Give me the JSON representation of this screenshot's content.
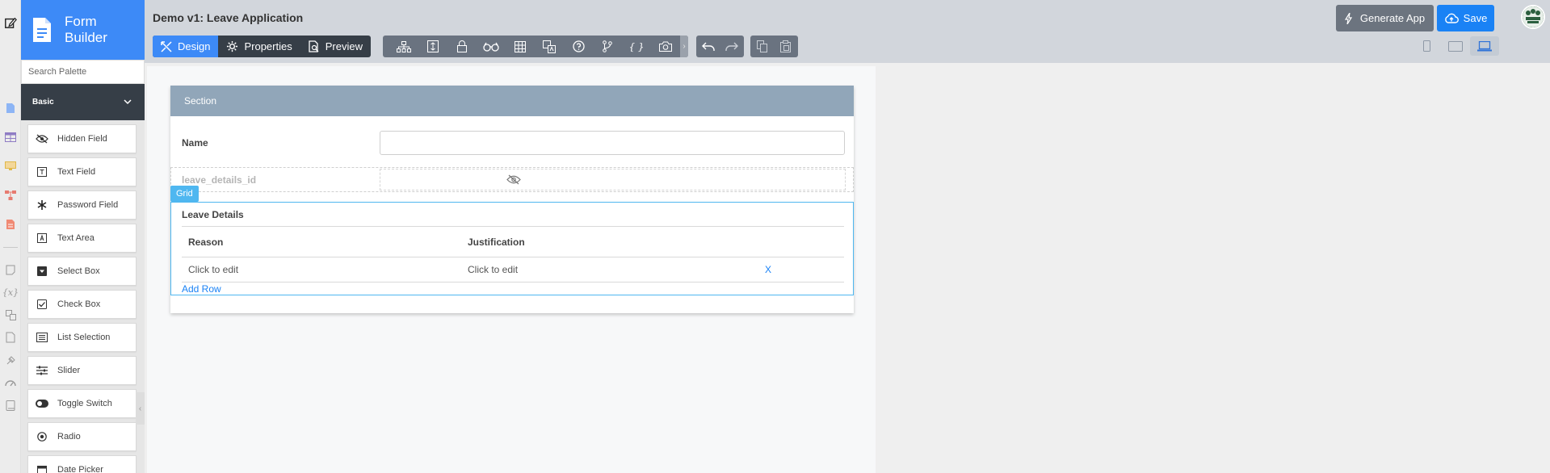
{
  "app": {
    "brand_line1": "Form",
    "brand_line2": "Builder",
    "title": "Demo v1: Leave Application",
    "accent": "#3d8af7"
  },
  "rail": {
    "icons": [
      "edit-icon",
      "form-icon",
      "table-icon",
      "monitor-icon",
      "workflow-icon",
      "report-icon",
      "note-icon",
      "variable-icon",
      "translate-icon",
      "file-icon",
      "plugin-icon",
      "dashboard-icon",
      "book-icon"
    ]
  },
  "palette": {
    "search_placeholder": "Search Palette",
    "category": "Basic",
    "items": [
      {
        "label": "Hidden Field",
        "icon": "eye-slash-icon"
      },
      {
        "label": "Text Field",
        "icon": "text-field-icon"
      },
      {
        "label": "Password Field",
        "icon": "asterisk-icon"
      },
      {
        "label": "Text Area",
        "icon": "text-area-icon"
      },
      {
        "label": "Select Box",
        "icon": "select-box-icon"
      },
      {
        "label": "Check Box",
        "icon": "checkbox-icon"
      },
      {
        "label": "List Selection",
        "icon": "list-icon"
      },
      {
        "label": "Slider",
        "icon": "slider-icon"
      },
      {
        "label": "Toggle Switch",
        "icon": "toggle-icon"
      },
      {
        "label": "Radio",
        "icon": "radio-icon"
      },
      {
        "label": "Date Picker",
        "icon": "calendar-icon"
      }
    ]
  },
  "toolbar": {
    "modes": [
      {
        "label": "Design",
        "icon": "design-icon",
        "active": true
      },
      {
        "label": "Properties",
        "icon": "gear-icon",
        "active": false
      },
      {
        "label": "Preview",
        "icon": "preview-icon",
        "active": false
      }
    ],
    "tools": [
      "tree-icon",
      "column-icon",
      "lock-icon",
      "glasses-icon",
      "grid-icon",
      "translate-icon",
      "help-icon",
      "branch-icon",
      "braces-icon",
      "camera-icon"
    ],
    "history": [
      "undo-icon",
      "redo-icon"
    ],
    "clipboard": [
      "copy-icon",
      "paste-icon"
    ],
    "generate_label": "Generate App",
    "save_label": "Save",
    "devices": [
      "phone-icon",
      "tablet-icon",
      "laptop-icon"
    ]
  },
  "form": {
    "section_title": "Section",
    "name_label": "Name",
    "name_value": "",
    "hidden_label": "leave_details_id",
    "grid_tag": "Grid",
    "grid_title": "Leave Details",
    "columns": [
      "Reason",
      "Justification"
    ],
    "rows": [
      {
        "reason": "Click to edit",
        "justification": "Click to edit",
        "delete": "X"
      }
    ],
    "add_row": "Add Row"
  }
}
